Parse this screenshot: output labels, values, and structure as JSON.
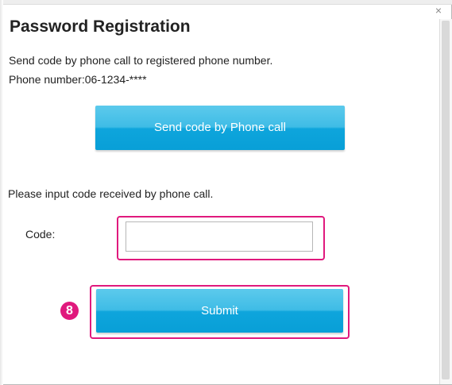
{
  "dialog": {
    "title": "Password Registration",
    "instruction": "Send code by phone call to registered phone number.",
    "phone_line": "Phone number:06-1234-****",
    "close_glyph": "×"
  },
  "send_button": {
    "label": "Send code by Phone call"
  },
  "code_section": {
    "prompt": "Please input code received by phone call.",
    "code_label": "Code:",
    "code_value": ""
  },
  "submit_button": {
    "label": "Submit"
  },
  "annotation": {
    "step_number": "8",
    "highlight_color": "#e0197d"
  },
  "colors": {
    "button_top": "#5ccaec",
    "button_bottom": "#089fd7",
    "button_text": "#ffffff"
  }
}
